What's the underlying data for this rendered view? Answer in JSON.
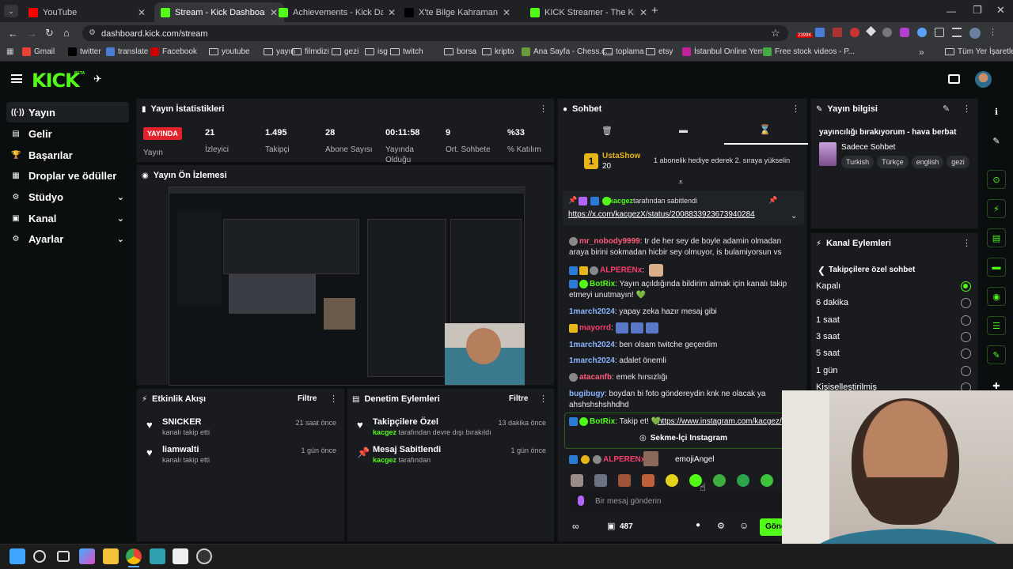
{
  "browser": {
    "tabs": [
      {
        "label": "YouTube",
        "color": "#ff0000",
        "active": false
      },
      {
        "label": "Stream - Kick Dashboard",
        "color": "#53fc18",
        "active": true
      },
      {
        "label": "Achievements - Kick Dashboard",
        "color": "#53fc18",
        "active": false
      },
      {
        "label": "X'te Bilge Kahraman: \"Kick Partn",
        "color": "#000000",
        "active": false
      },
      {
        "label": "KICK Streamer - The KICK Partn",
        "color": "#53fc18",
        "active": false
      }
    ],
    "new_tab": "+",
    "url": "dashboard.kick.com/stream",
    "ext_count": "2399K",
    "bookmarks": [
      "Gmail",
      "twitter",
      "translate",
      "Facebook",
      "youtube",
      "yayın",
      "filmdizi",
      "gezi",
      "isg",
      "twitch",
      "borsa",
      "kripto",
      "Ana Sayfa - Chess.c...",
      "toplama",
      "etsy",
      "İstanbul Online Yem...",
      "Free stock videos - P..."
    ],
    "bookmarks_more": "»",
    "all_bookmarks": "Tüm Yer İşaretleri"
  },
  "header": {
    "logo": "KICK",
    "beta": "BETA"
  },
  "sidebar": {
    "items": [
      {
        "label": "Yayın",
        "icon": "broadcast-icon",
        "glyph": "((·))",
        "chev": false
      },
      {
        "label": "Gelir",
        "icon": "dollar-icon",
        "glyph": "▤",
        "chev": false
      },
      {
        "label": "Başarılar",
        "icon": "trophy-icon",
        "glyph": "🏆",
        "chev": false
      },
      {
        "label": "Droplar ve ödüller",
        "icon": "gift-icon",
        "glyph": "▦",
        "chev": false
      },
      {
        "label": "Stüdyo",
        "icon": "studio-icon",
        "glyph": "⚙",
        "chev": true
      },
      {
        "label": "Kanal",
        "icon": "channel-icon",
        "glyph": "▣",
        "chev": true
      },
      {
        "label": "Ayarlar",
        "icon": "settings-icon",
        "glyph": "⚙",
        "chev": true
      }
    ]
  },
  "stats": {
    "title": "Yayın İstatistikleri",
    "live": "YAYINDA",
    "items": [
      {
        "value": "21",
        "label": "İzleyici"
      },
      {
        "value": "1.495",
        "label": "Takipçi"
      },
      {
        "value": "28",
        "label": "Abone Sayısı"
      },
      {
        "value": "00:11:58",
        "label": "Yayında Olduğu"
      },
      {
        "value": "9",
        "label": "Ort. Sohbete"
      },
      {
        "value": "%33",
        "label": "% Katılım"
      }
    ],
    "under_live": "Yayın"
  },
  "preview": {
    "title": "Yayın Ön İzlemesi"
  },
  "activity": {
    "title": "Etkinlik Akışı",
    "filter": "Filtre",
    "items": [
      {
        "name": "SNICKER",
        "sub": "kanalı takip etti",
        "time": "21 saat önce"
      },
      {
        "name": "liamwalti",
        "sub": "kanalı takip etti",
        "time": "1 gün önce"
      }
    ]
  },
  "moderation": {
    "title": "Denetim Eylemleri",
    "filter": "Filtre",
    "items": [
      {
        "name": "Takipçilere Özel",
        "user": "kacgez",
        "sub": "tarafından devre dışı bırakıldı",
        "time": "13 dakika önce"
      },
      {
        "name": "Mesaj Sabitlendi",
        "user": "kacgez",
        "sub": "tarafından",
        "time": "1 gün önce"
      }
    ]
  },
  "chat": {
    "title": "Sohbet",
    "top_user": "UstaShow",
    "top_rank": "1",
    "top_sub": "20",
    "top_msg": "1 abonelik hediye ederek 2. sıraya yükselin",
    "pinned_by": "kacgez",
    "pinned_suffix": "tarafından sabitlendi",
    "pinned_link": "https://x.com/kacgezX/status/2008833923673940284",
    "messages": [
      {
        "user": "mr_nobody9999",
        "color": "#ff5b7a",
        "text": ": tr de her sey de boyle adamin olmadan araya birini sokmadan hicbir sey olmuyor, is bulamiyorsun vs"
      },
      {
        "user": "ALPERENx",
        "color": "#ff3d6e",
        "text": ":"
      },
      {
        "user": "BotRix",
        "color": "#53fc18",
        "text": ": Yayın açıldığında bildirim almak için kanalı takip etmeyi unutmayın! 💚"
      },
      {
        "user": "1march2024",
        "color": "#8ab4ff",
        "text": ": yapay zeka hazır mesaj gibi"
      },
      {
        "user": "mayorrd",
        "color": "#ff3d6e",
        "text": ":"
      },
      {
        "user": "1march2024",
        "color": "#8ab4ff",
        "text": ": ben olsam twitche geçerdim"
      },
      {
        "user": "1march2024",
        "color": "#8ab4ff",
        "text": ": adalet önemli"
      },
      {
        "user": "atacanfb",
        "color": "#ff5b7a",
        "text": ": emek hırsızlığı"
      },
      {
        "user": "bugibugy",
        "color": "#8ab4ff",
        "text": ": boydan bi foto göndereydin knk ne olacak ya ahshshshshhdhd"
      },
      {
        "user": "BotRix",
        "color": "#53fc18",
        "text": ": Takip et! 💚"
      }
    ],
    "botrix_link": "https://www.instagram.com/kacgez/",
    "insta_btn": "Sekme-İçi Instagram",
    "last_user": "ALPERENx",
    "last_color": "#ff3d6e",
    "emoji_label": "emojiAngel",
    "input_placeholder": "Bir mesaj gönderin",
    "points": "487",
    "send": "Gönder"
  },
  "info": {
    "title": "Yayın bilgisi",
    "stream_title": "yayıncılığı bırakıyorum - hava berbat",
    "category": "Sadece Sohbet",
    "tags": [
      "Turkish",
      "Türkçe",
      "english",
      "gezi"
    ]
  },
  "channel_actions": {
    "title": "Kanal Eylemleri",
    "sub_title": "Takipçilere özel sohbet",
    "options": [
      {
        "label": "Kapalı",
        "on": true
      },
      {
        "label": "6 dakika",
        "on": false
      },
      {
        "label": "1 saat",
        "on": false
      },
      {
        "label": "3 saat",
        "on": false
      },
      {
        "label": "5 saat",
        "on": false
      },
      {
        "label": "1 gün",
        "on": false
      },
      {
        "label": "Kişiselleştirilmiş",
        "on": false
      }
    ]
  }
}
